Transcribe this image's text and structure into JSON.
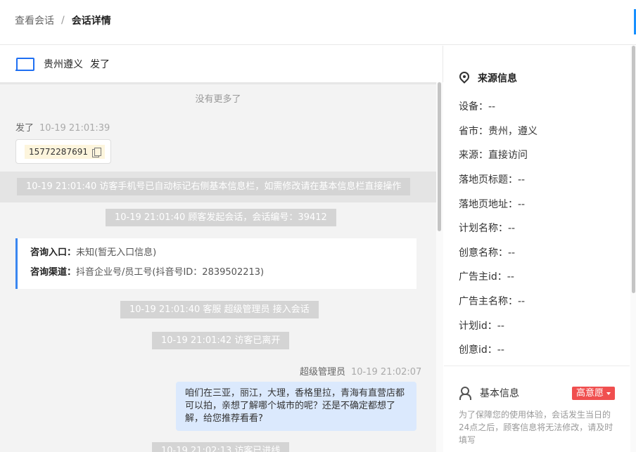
{
  "breadcrumb": {
    "prev": "查看会话",
    "sep": "/",
    "current": "会话详情"
  },
  "visitor": {
    "location": "贵州遵义",
    "name": "发了"
  },
  "chat": {
    "no_more": "没有更多了",
    "msg1": {
      "sender": "发了",
      "time": "10-19 21:01:39",
      "phone": "15772287691"
    },
    "system_notices": [
      "10-19 21:01:40 访客手机号已自动标记右侧基本信息栏，如需修改请在基本信息栏直接操作",
      "10-19 21:01:40 顾客发起会话，会话编号：39412",
      "10-19 21:01:40 客服 超级管理员 接入会话",
      "10-19 21:01:42 访客已离开",
      "10-19 21:02:13 访客已进线"
    ],
    "entry": {
      "label1": "咨询入口：",
      "value1": "未知(暂无入口信息)",
      "label2": "咨询渠道：",
      "value2": "抖音企业号/员工号(抖音号ID：2839502213)"
    },
    "msg2": {
      "sender": "超级管理员",
      "time": "10-19 21:02:07",
      "text": "咱们在三亚，丽江，大理，香格里拉，青海有直营店都可以拍，亲想了解哪个城市的呢？还是不确定都想了解，给您推荐看看?"
    }
  },
  "source": {
    "title": "来源信息",
    "fields": [
      "设备：--",
      "省市：贵州，遵义",
      "来源：直接访问",
      "落地页标题：--",
      "落地页地址：--",
      "计划名称：--",
      "创意名称：--",
      "广告主id：--",
      "广告主名称：--",
      "计划id：--",
      "创意id：--"
    ]
  },
  "basic": {
    "title": "基本信息",
    "tag": "高意愿",
    "note": "为了保障您的使用体验，会话发生当日的24点之后，顾客信息将无法修改，请及时填写"
  },
  "colors": {
    "accent": "#1f6ff2",
    "tag": "#f04f4f",
    "bubble": "#dbe9fd"
  }
}
